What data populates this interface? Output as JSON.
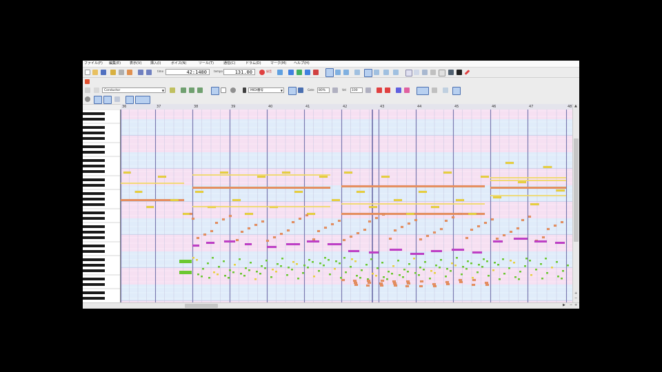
{
  "menu": {
    "items": [
      "ファイル(F)",
      "編集(E)",
      "表示(V)",
      "挿入(I)",
      "ボイス(N)",
      "ツール(T)",
      "通信(C)",
      "ドラム(D)",
      "マーク(M)",
      "ヘルプ(H)"
    ]
  },
  "toolbar": {
    "time_label": "time",
    "position": "42:1480",
    "tempo_label": "tempo",
    "tempo": "131.00",
    "record_label": "録音",
    "track_name": "Conductor",
    "voice_select": "MIDI番号",
    "gate_label": "Gate",
    "gate_value": "80%",
    "vel_label": "Vel",
    "vel_value": "100"
  },
  "timeline": {
    "measures": [
      "36",
      "37",
      "38",
      "39",
      "40",
      "41",
      "42",
      "43",
      "44",
      "45",
      "46",
      "47",
      "48"
    ]
  },
  "colors": {
    "grid_pink": "#f6e0f2",
    "grid_blue": "#e0ecfa",
    "bar_line": "#7a7ab0",
    "note_yellow": "#e8d040",
    "note_orange": "#e89060",
    "note_magenta": "#c040c8",
    "note_green": "#6cc832"
  }
}
